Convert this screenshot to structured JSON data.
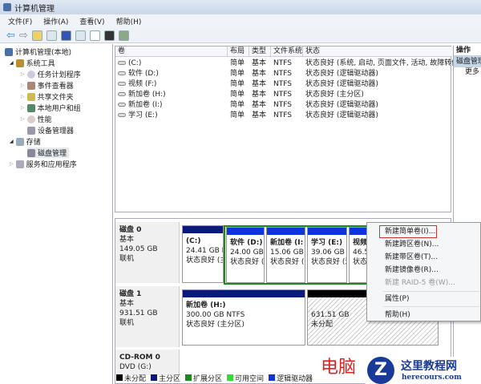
{
  "window": {
    "title": "计算机管理"
  },
  "menu": [
    "文件(F)",
    "操作(A)",
    "查看(V)",
    "帮助(H)"
  ],
  "tree": [
    {
      "label": "计算机管理(本地)",
      "level": 0
    },
    {
      "label": "系统工具",
      "level": 1
    },
    {
      "label": "任务计划程序",
      "level": 2
    },
    {
      "label": "事件查看器",
      "level": 2
    },
    {
      "label": "共享文件夹",
      "level": 2
    },
    {
      "label": "本地用户和组",
      "level": 2
    },
    {
      "label": "性能",
      "level": 2
    },
    {
      "label": "设备管理器",
      "level": 2
    },
    {
      "label": "存储",
      "level": 1
    },
    {
      "label": "磁盘管理",
      "level": 2
    },
    {
      "label": "服务和应用程序",
      "level": 1
    }
  ],
  "list": {
    "headers": [
      "卷",
      "布局",
      "类型",
      "文件系统",
      "状态"
    ],
    "rows": [
      [
        "(C:)",
        "简单",
        "基本",
        "NTFS",
        "状态良好 (系统, 启动, 页面文件, 活动, 故障转储"
      ],
      [
        "软件 (D:)",
        "简单",
        "基本",
        "NTFS",
        "状态良好 (逻辑驱动器)"
      ],
      [
        "视频 (F:)",
        "简单",
        "基本",
        "NTFS",
        "状态良好 (逻辑驱动器)"
      ],
      [
        "新加卷 (H:)",
        "简单",
        "基本",
        "NTFS",
        "状态良好 (主分区)"
      ],
      [
        "新加卷 (I:)",
        "简单",
        "基本",
        "NTFS",
        "状态良好 (逻辑驱动器)"
      ],
      [
        "学习 (E:)",
        "简单",
        "基本",
        "NTFS",
        "状态良好 (逻辑驱动器)"
      ]
    ]
  },
  "actions": {
    "title": "操作",
    "item": "磁盘管理",
    "more": "更多"
  },
  "disks": [
    {
      "name": "磁盘 0",
      "type": "基本",
      "size": "149.05 GB",
      "status": "联机",
      "parts": [
        {
          "name": "(C:)",
          "size": "24.41 GB N",
          "status": "状态良好 (主"
        },
        {
          "name": "软件 (D:)",
          "size": "24.00 GB",
          "status": "状态良好 ("
        },
        {
          "name": "新加卷 (I:",
          "size": "15.06 GB",
          "status": "状态良好 ("
        },
        {
          "name": "学习 (E:)",
          "size": "39.06 GB N",
          "status": "状态良好 (逻"
        },
        {
          "name": "视频",
          "size": "46.5",
          "status": "状态"
        }
      ]
    },
    {
      "name": "磁盘 1",
      "type": "基本",
      "size": "931.51 GB",
      "status": "联机",
      "parts": [
        {
          "name": "新加卷 (H:)",
          "size": "300.00 GB NTFS",
          "status": "状态良好 (主分区)"
        },
        {
          "name": "",
          "size": "631.51 GB",
          "status": "未分配"
        }
      ]
    },
    {
      "name": "CD-ROM 0",
      "type": "DVD (G:)"
    }
  ],
  "context_menu": [
    {
      "label": "新建简单卷(I)...",
      "enabled": true,
      "highlight": true
    },
    {
      "label": "新建跨区卷(N)...",
      "enabled": true
    },
    {
      "label": "新建带区卷(T)...",
      "enabled": true
    },
    {
      "label": "新建镜像卷(R)...",
      "enabled": true
    },
    {
      "label": "新建 RAID-5 卷(W)...",
      "enabled": false
    },
    {
      "label": "属性(P)",
      "enabled": true
    },
    {
      "label": "帮助(H)",
      "enabled": true
    }
  ],
  "legend": [
    {
      "label": "未分配",
      "color": "#000000"
    },
    {
      "label": "主分区",
      "color": "#0a1a7a"
    },
    {
      "label": "扩展分区",
      "color": "#1a8a1a"
    },
    {
      "label": "可用空间",
      "color": "#33dd33"
    },
    {
      "label": "逻辑驱动器",
      "color": "#1133dd"
    }
  ],
  "watermark": {
    "text1": "电脑",
    "text2": "这里教程网",
    "text3": "herecours.com"
  }
}
